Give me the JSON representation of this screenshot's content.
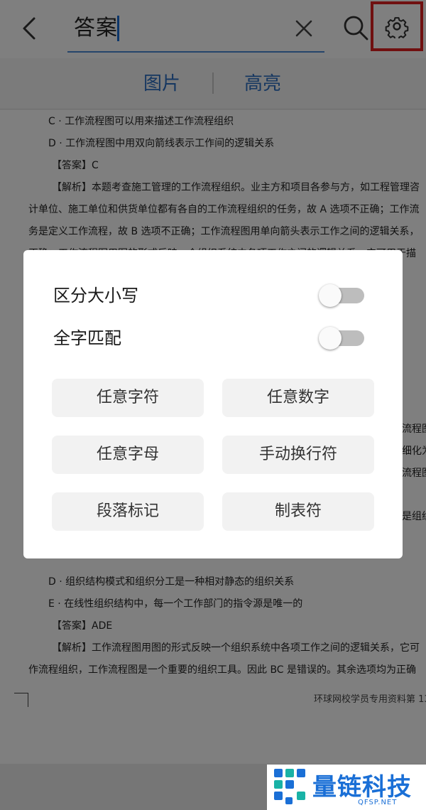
{
  "topbar": {
    "search_query": "答案",
    "icons": [
      "back-arrow-icon",
      "clear-icon",
      "search-icon",
      "gear-icon"
    ]
  },
  "tabs": [
    {
      "label": "图片"
    },
    {
      "label": "高亮"
    }
  ],
  "document": {
    "lines": [
      "C · 工作流程图可以用来描述工作流程组织",
      "D · 工作流程图中用双向箭线表示工作间的逻辑关系",
      "【答案】C",
      "【解析】本题考查施工管理的工作流程组织。业主方和项目各参与方，如工程管理咨",
      "计单位、施工单位和供货单位都有各自的工作流程组织的任务，故 A 选项不正确；工作流",
      "务是定义工作流程，故 B 选项不正确；工作流程图用单向箭头表示工作之间的逻辑关系，",
      "正确：工作流程图用图的形式反映一个组织系统中各项工作之间的逻辑关系，它可用于描",
      "D · 组织结构模式和组织分工是一种相对静态的组织关系",
      "E · 在线性组织结构中，每一个工作部门的指令源是唯一的",
      "【答案】ADE",
      "【解析】工作流程图用图的形式反映一个组织系统中各项工作之间的逻辑关系，它可",
      "作流程组织，工作流程图是一个重要的组织工具。因此 BC 是错误的。其余选项均为正确"
    ],
    "right_fragments": [
      "流程图",
      "细化为",
      "流程图",
      "是组织"
    ],
    "footer": "环球网校学员专用资料第 13"
  },
  "dialog": {
    "options": [
      {
        "label": "区分大小写",
        "enabled": false
      },
      {
        "label": "全字匹配",
        "enabled": false
      }
    ],
    "chips": [
      "任意字符",
      "任意数字",
      "任意字母",
      "手动换行符",
      "段落标记",
      "制表符"
    ]
  },
  "watermark": {
    "brand": "量链科技",
    "domain": "QFSP.NET"
  },
  "colors": {
    "accent": "#2c6fc2",
    "highlight_border": "#e02020",
    "switch_off": "#bdbdbd"
  }
}
